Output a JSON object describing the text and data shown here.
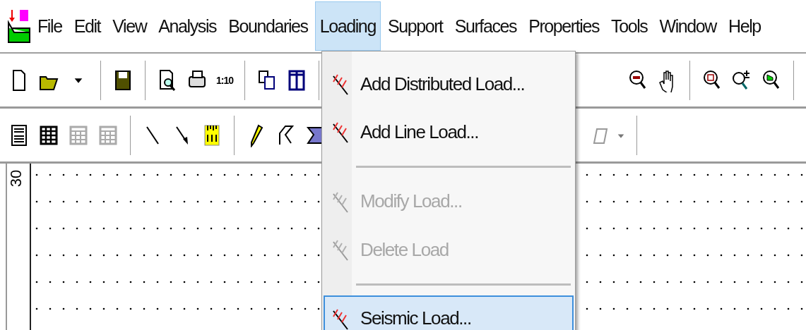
{
  "menu_bar": {
    "items": [
      {
        "label": "File",
        "selected": false
      },
      {
        "label": "Edit",
        "selected": false
      },
      {
        "label": "View",
        "selected": false
      },
      {
        "label": "Analysis",
        "selected": false
      },
      {
        "label": "Boundaries",
        "selected": false
      },
      {
        "label": "Loading",
        "selected": true
      },
      {
        "label": "Support",
        "selected": false
      },
      {
        "label": "Surfaces",
        "selected": false
      },
      {
        "label": "Properties",
        "selected": false
      },
      {
        "label": "Tools",
        "selected": false
      },
      {
        "label": "Window",
        "selected": false
      },
      {
        "label": "Help",
        "selected": false
      }
    ]
  },
  "toolbar": {
    "scale_button": "1:10"
  },
  "canvas": {
    "axis_label": "30"
  },
  "loading_menu": {
    "entries": [
      {
        "kind": "item",
        "label": "Add Distributed Load...",
        "disabled": false,
        "selected": false
      },
      {
        "kind": "item",
        "label": "Add Line Load...",
        "disabled": false,
        "selected": false
      },
      {
        "kind": "separator"
      },
      {
        "kind": "item",
        "label": "Modify Load...",
        "disabled": true,
        "selected": false
      },
      {
        "kind": "item",
        "label": "Delete Load",
        "disabled": true,
        "selected": false
      },
      {
        "kind": "separator"
      },
      {
        "kind": "item",
        "label": "Seismic Load...",
        "disabled": false,
        "selected": true
      }
    ]
  }
}
